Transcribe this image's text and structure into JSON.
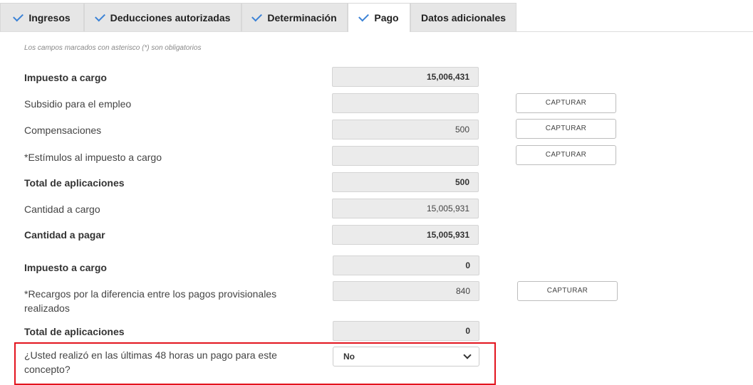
{
  "tabs": [
    {
      "label": "Ingresos",
      "checked": true
    },
    {
      "label": "Deducciones autorizadas",
      "checked": true
    },
    {
      "label": "Determinación",
      "checked": true
    },
    {
      "label": "Pago",
      "checked": true,
      "active": true
    },
    {
      "label": "Datos adicionales",
      "checked": false
    }
  ],
  "note": "Los campos marcados con asterisco (*) son obligatorios",
  "capture_label": "CAPTURAR",
  "rows": [
    {
      "label": "Impuesto a cargo",
      "value": "15,006,431"
    },
    {
      "label": "Subsidio para el empleo",
      "value": ""
    },
    {
      "label": "Compensaciones",
      "value": "500"
    },
    {
      "label": "*Estímulos al impuesto a cargo",
      "value": ""
    },
    {
      "label": "Total de aplicaciones",
      "value": "500"
    },
    {
      "label": "Cantidad a cargo",
      "value": "15,005,931"
    },
    {
      "label": "Cantidad a pagar",
      "value": "15,005,931"
    },
    {
      "label": "Impuesto a cargo",
      "value": "0"
    },
    {
      "label_line1": "*Recargos por la diferencia entre los pagos provisionales",
      "label_line2": "realizados",
      "value": "840"
    },
    {
      "label": "Total de aplicaciones",
      "value": "0"
    }
  ],
  "question": {
    "line1": "¿Usted realizó en las últimas 48 horas un pago para este",
    "line2": "concepto?",
    "selected": "No"
  },
  "colors": {
    "check": "#3b82d6",
    "highlight": "#e3141e"
  }
}
